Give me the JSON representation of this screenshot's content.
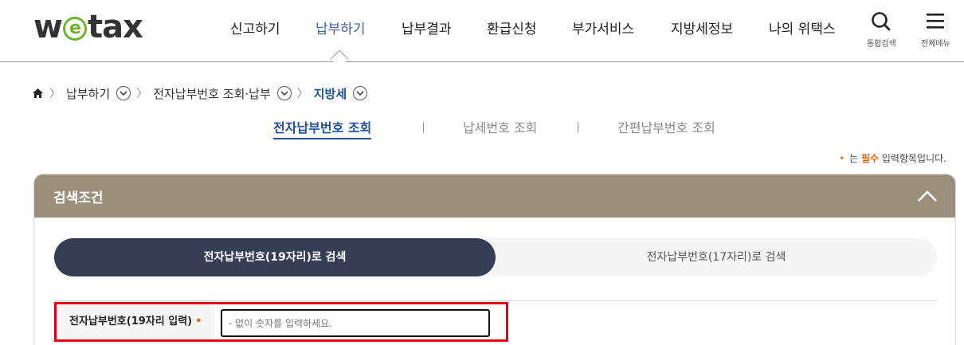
{
  "header": {
    "logo": {
      "prefix": "w",
      "e": "e",
      "suffix": "tax"
    },
    "nav": [
      {
        "label": "신고하기",
        "active": false
      },
      {
        "label": "납부하기",
        "active": true
      },
      {
        "label": "납부결과",
        "active": false
      },
      {
        "label": "환급신청",
        "active": false
      },
      {
        "label": "부가서비스",
        "active": false
      },
      {
        "label": "지방세정보",
        "active": false
      },
      {
        "label": "나의 위택스",
        "active": false
      }
    ],
    "util": {
      "search_label": "통합검색",
      "menu_label": "전체메뉴"
    }
  },
  "breadcrumb": {
    "level1": "납부하기",
    "level2": "전자납부번호 조회·납부",
    "current": "지방세"
  },
  "subtabs": [
    {
      "label": "전자납부번호 조회",
      "active": true
    },
    {
      "label": "납세번호 조회",
      "active": false
    },
    {
      "label": "간편납부번호 조회",
      "active": false
    }
  ],
  "required_note": {
    "dot": "•",
    "prefix": "는 ",
    "required": "필수",
    "suffix": " 입력항목입니다."
  },
  "panel": {
    "title": "검색조건",
    "toggle": {
      "option_a": "전자납부번호(19자리)로 검색",
      "option_b": "전자납부번호(17자리)로 검색",
      "selected": "option_a"
    },
    "field": {
      "label": "전자납부번호(19자리 입력)",
      "required_dot": "•",
      "value": "",
      "placeholder": "- 없이 숫자를 입력하세요."
    }
  },
  "colors": {
    "accent_blue": "#1f4fa0",
    "panel_header": "#9b8f7c",
    "toggle_active": "#353e55",
    "required": "#e56a17",
    "highlight_border": "#e60012"
  }
}
